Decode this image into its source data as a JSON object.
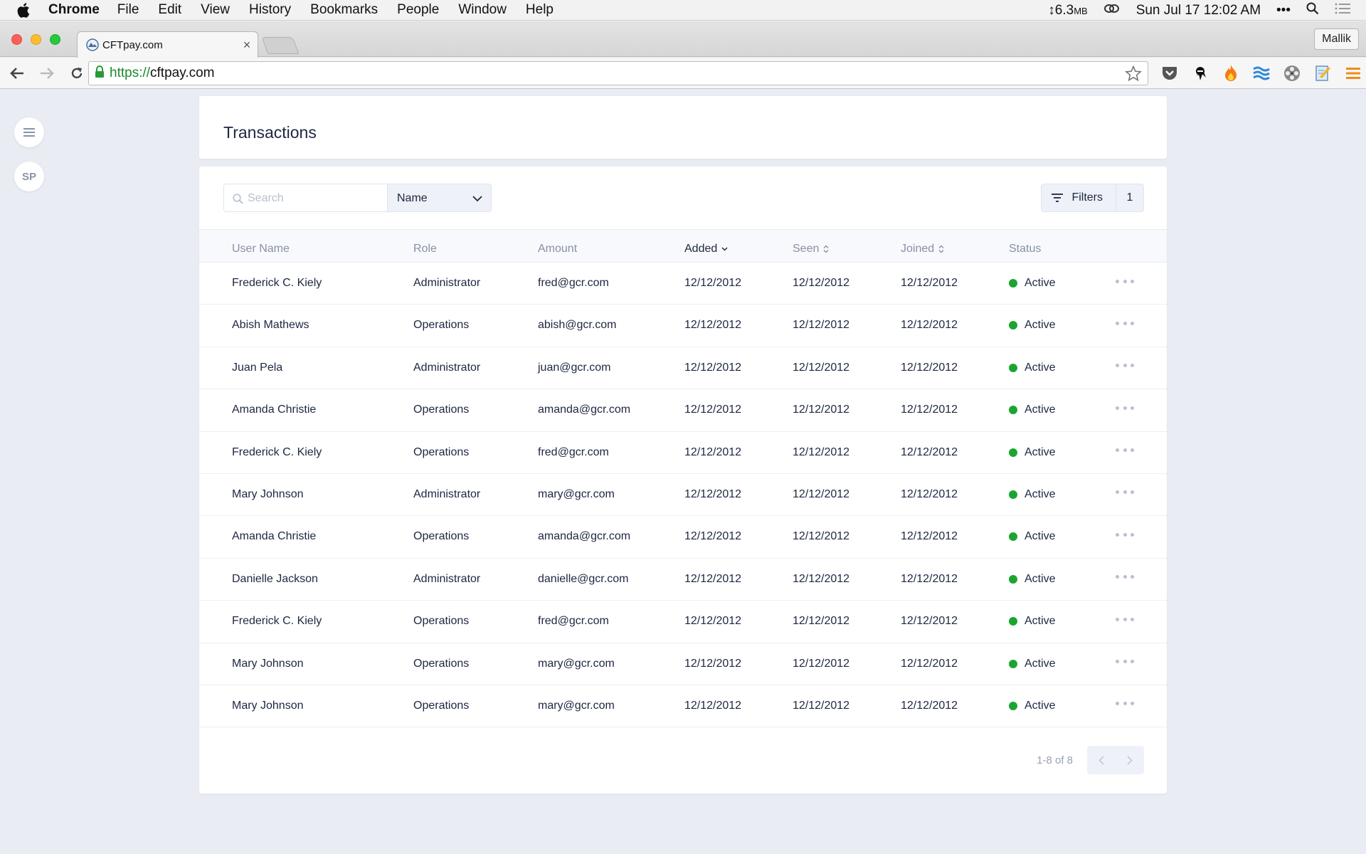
{
  "menubar": {
    "app": "Chrome",
    "items": [
      "File",
      "Edit",
      "View",
      "History",
      "Bookmarks",
      "People",
      "Window",
      "Help"
    ],
    "memory": "↕6.3",
    "memory_unit": "MB",
    "datetime": "Sun Jul 17  12:02 AM",
    "more": "•••"
  },
  "browser": {
    "tab_title": "CFTpay.com",
    "tab_close": "×",
    "profile": "Mallik",
    "url_scheme": "https://",
    "url_host": "cftpay.com"
  },
  "sidebar": {
    "menu_icon": "hamburger-icon",
    "avatar_initials": "SP"
  },
  "page": {
    "title": "Transactions"
  },
  "search": {
    "placeholder": "Search",
    "field_selected": "Name"
  },
  "filters": {
    "label": "Filters",
    "count": "1"
  },
  "table": {
    "columns": {
      "user_name": "User Name",
      "role": "Role",
      "amount": "Amount",
      "added": "Added",
      "seen": "Seen",
      "joined": "Joined",
      "status": "Status"
    },
    "rows": [
      {
        "name": "Frederick C. Kiely",
        "role": "Administrator",
        "amount": "fred@gcr.com",
        "added": "12/12/2012",
        "seen": "12/12/2012",
        "joined": "12/12/2012",
        "status": "Active"
      },
      {
        "name": "Abish Mathews",
        "role": "Operations",
        "amount": "abish@gcr.com",
        "added": "12/12/2012",
        "seen": "12/12/2012",
        "joined": "12/12/2012",
        "status": "Active"
      },
      {
        "name": "Juan Pela",
        "role": "Administrator",
        "amount": "juan@gcr.com",
        "added": "12/12/2012",
        "seen": "12/12/2012",
        "joined": "12/12/2012",
        "status": "Active"
      },
      {
        "name": "Amanda Christie",
        "role": "Operations",
        "amount": "amanda@gcr.com",
        "added": "12/12/2012",
        "seen": "12/12/2012",
        "joined": "12/12/2012",
        "status": "Active"
      },
      {
        "name": "Frederick C. Kiely",
        "role": "Operations",
        "amount": "fred@gcr.com",
        "added": "12/12/2012",
        "seen": "12/12/2012",
        "joined": "12/12/2012",
        "status": "Active"
      },
      {
        "name": "Mary Johnson",
        "role": "Administrator",
        "amount": "mary@gcr.com",
        "added": "12/12/2012",
        "seen": "12/12/2012",
        "joined": "12/12/2012",
        "status": "Active"
      },
      {
        "name": "Amanda Christie",
        "role": "Operations",
        "amount": "amanda@gcr.com",
        "added": "12/12/2012",
        "seen": "12/12/2012",
        "joined": "12/12/2012",
        "status": "Active"
      },
      {
        "name": "Danielle Jackson",
        "role": "Administrator",
        "amount": "danielle@gcr.com",
        "added": "12/12/2012",
        "seen": "12/12/2012",
        "joined": "12/12/2012",
        "status": "Active"
      },
      {
        "name": "Frederick C. Kiely",
        "role": "Operations",
        "amount": "fred@gcr.com",
        "added": "12/12/2012",
        "seen": "12/12/2012",
        "joined": "12/12/2012",
        "status": "Active"
      },
      {
        "name": "Mary Johnson",
        "role": "Operations",
        "amount": "mary@gcr.com",
        "added": "12/12/2012",
        "seen": "12/12/2012",
        "joined": "12/12/2012",
        "status": "Active"
      },
      {
        "name": "Mary Johnson",
        "role": "Operations",
        "amount": "mary@gcr.com",
        "added": "12/12/2012",
        "seen": "12/12/2012",
        "joined": "12/12/2012",
        "status": "Active"
      }
    ]
  },
  "pagination": {
    "range": "1-8 of 8"
  },
  "colors": {
    "status_active": "#1aa531",
    "page_background": "#e9ecf3",
    "heading_text": "#1d2740",
    "muted_text": "#8790a6"
  }
}
